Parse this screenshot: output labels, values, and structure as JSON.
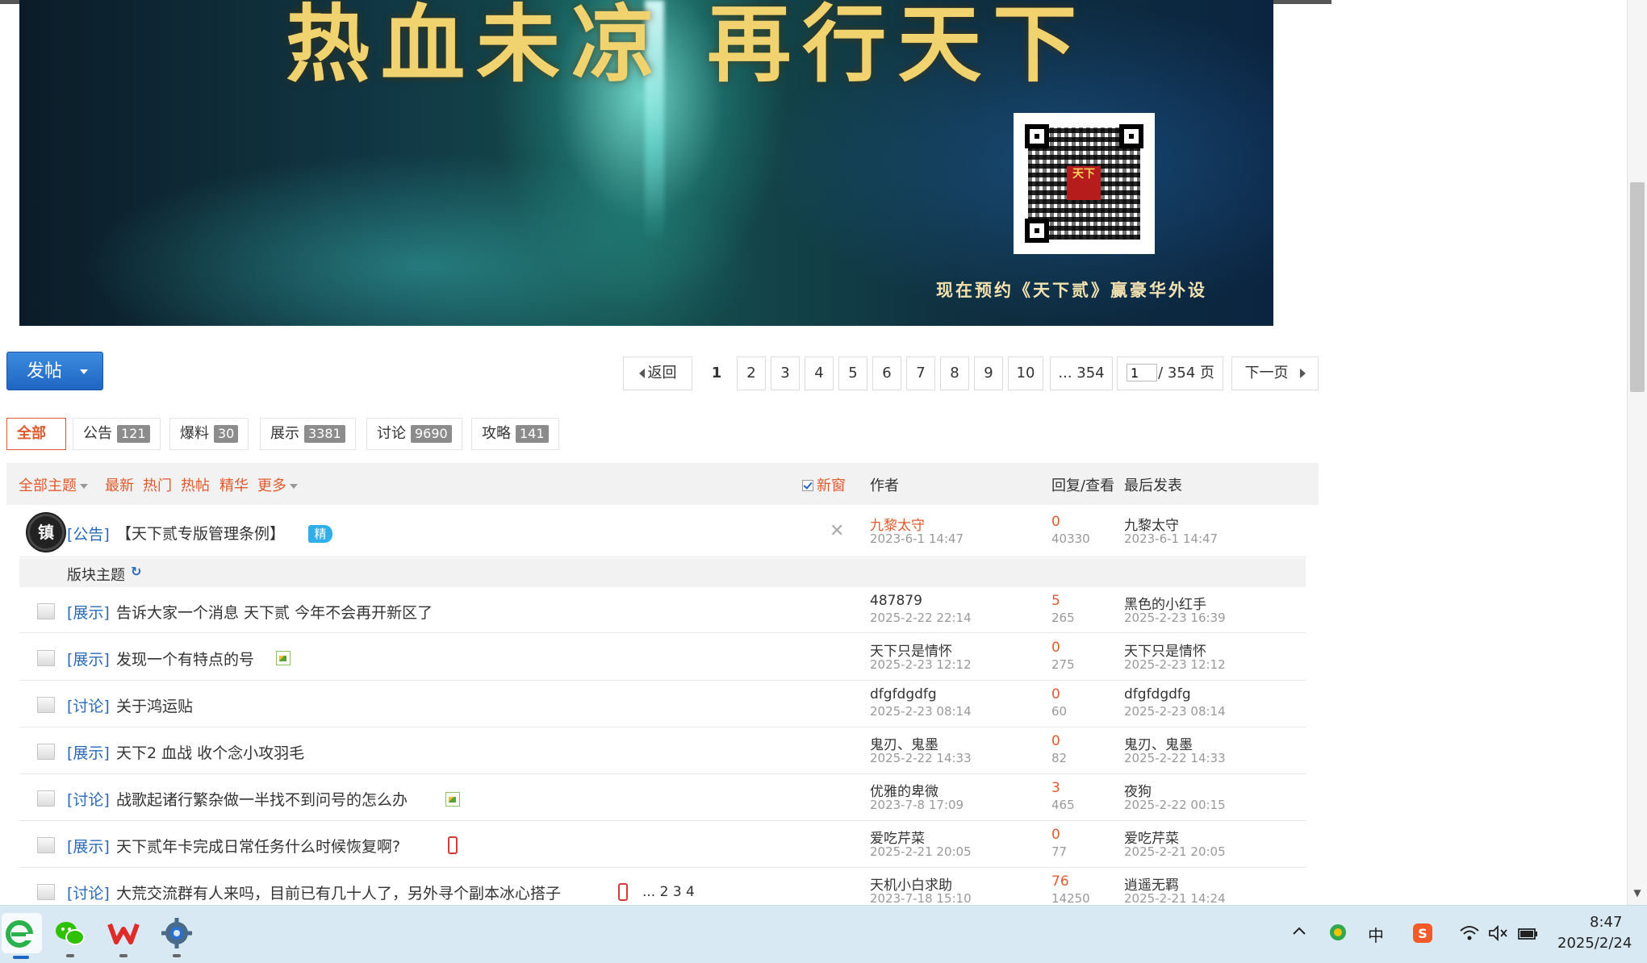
{
  "banner": {
    "title": "热血未凉 再行天下",
    "qr_logo": "天下",
    "caption": "现在预约《天下贰》赢豪华外设"
  },
  "toolbar": {
    "post_label": "发帖",
    "back_label": "返回",
    "pages": [
      "1",
      "2",
      "3",
      "4",
      "5",
      "6",
      "7",
      "8",
      "9",
      "10"
    ],
    "last_page_label": "... 354",
    "page_input_value": "1",
    "total_pages_label": "/ 354 页",
    "next_label": "下一页"
  },
  "categories": [
    {
      "label": "全部",
      "count": ""
    },
    {
      "label": "公告",
      "count": "121"
    },
    {
      "label": "爆料",
      "count": "30"
    },
    {
      "label": "展示",
      "count": "3381"
    },
    {
      "label": "讨论",
      "count": "9690"
    },
    {
      "label": "攻略",
      "count": "141"
    }
  ],
  "thread_header": {
    "all_topics": "全部主题",
    "latest": "最新",
    "hot": "热门",
    "hot_posts": "热帖",
    "essence": "精华",
    "more": "更多",
    "new_window": "新窗",
    "author_col": "作者",
    "reply_view_col": "回复/查看",
    "last_post_col": "最后发表"
  },
  "pinned": {
    "avatar_text": "镇",
    "tag": "[公告]",
    "title": "【天下贰专版管理条例】",
    "badge": "精",
    "author": "九黎太守",
    "author_date": "2023-6-1 14:47",
    "replies": "0",
    "views": "40330",
    "last_author": "九黎太守",
    "last_date": "2023-6-1 14:47"
  },
  "section_label": "版块主题",
  "threads": [
    {
      "tag": "[展示]",
      "title": "告诉大家一个消息 天下贰 今年不会再开新区了",
      "author": "487879",
      "author_date": "2025-2-22 22:14",
      "replies": "5",
      "views": "265",
      "last_author": "黑色的小红手",
      "last_date": "2025-2-23 16:39"
    },
    {
      "tag": "[展示]",
      "title": "发现一个有特点的号",
      "author": "天下只是情怀",
      "author_date": "2025-2-23 12:12",
      "replies": "0",
      "views": "275",
      "last_author": "天下只是情怀",
      "last_date": "2025-2-23 12:12"
    },
    {
      "tag": "[讨论]",
      "title": "关于鸿运贴",
      "author": "dfgfdgdfg",
      "author_date": "2025-2-23 08:14",
      "replies": "0",
      "views": "60",
      "last_author": "dfgfdgdfg",
      "last_date": "2025-2-23 08:14"
    },
    {
      "tag": "[展示]",
      "title": "天下2 血战 收个念小攻羽毛",
      "author": "鬼刃、鬼墨",
      "author_date": "2025-2-22 14:33",
      "replies": "0",
      "views": "82",
      "last_author": "鬼刃、鬼墨",
      "last_date": "2025-2-22 14:33"
    },
    {
      "tag": "[讨论]",
      "title": "战歌起诸行繁杂做一半找不到问号的怎么办",
      "author": "优雅的卑微",
      "author_date": "2023-7-8 17:09",
      "replies": "3",
      "views": "465",
      "last_author": "夜狗",
      "last_date": "2025-2-22 00:15"
    },
    {
      "tag": "[展示]",
      "title": "天下贰年卡完成日常任务什么时候恢复啊?",
      "author": "爱吃芹菜",
      "author_date": "2025-2-21 20:05",
      "replies": "0",
      "views": "77",
      "last_author": "爱吃芹菜",
      "last_date": "2025-2-21 20:05"
    },
    {
      "tag": "[讨论]",
      "title": "大荒交流群有人来吗，目前已有几十人了，另外寻个副本冰心搭子",
      "author": "天机小白求助",
      "author_date": "2023-7-18 15:10",
      "replies": "76",
      "views": "14250",
      "last_author": "逍遥无羁",
      "last_date": "2025-2-21 14:24",
      "page_links": "... 2 3 4"
    }
  ],
  "taskbar": {
    "ime_label": "中",
    "time": "8:47",
    "date": "2025/2/24"
  },
  "colors": {
    "accent_orange": "#e05a2d",
    "link_blue": "#2868b8",
    "post_button": "#1f66c2",
    "taskbar": "#d9e9f3"
  },
  "icons": {
    "taskbar_apps": [
      "edge-icon",
      "wechat-icon",
      "wps-icon",
      "settings-icon"
    ],
    "tray": [
      "chevron-up-icon",
      "shield-icon",
      "ime-icon",
      "sogou-icon",
      "wifi-icon",
      "volume-muted-icon",
      "battery-icon"
    ]
  }
}
